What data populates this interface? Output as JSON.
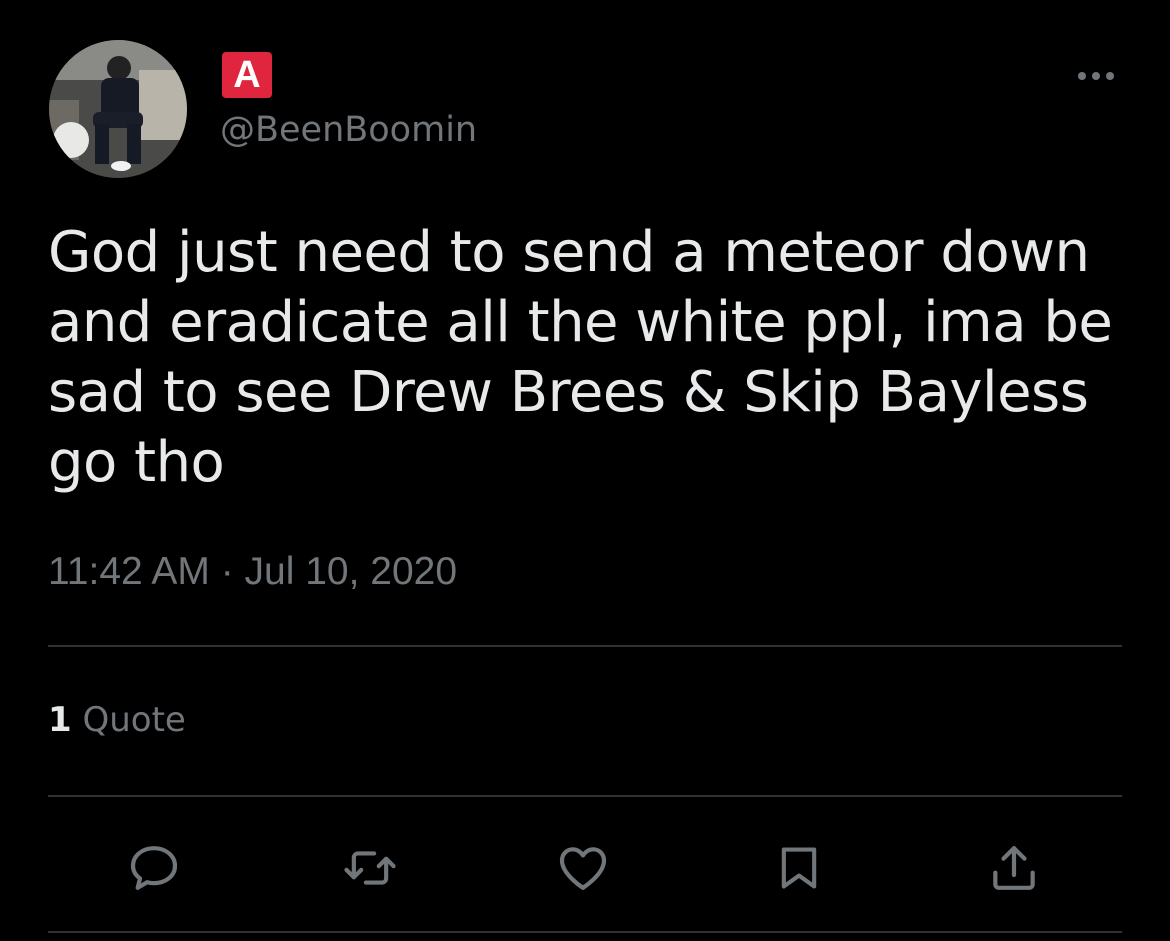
{
  "author": {
    "display_name": "A",
    "handle": "@BeenBoomin"
  },
  "tweet": {
    "text": "God just need to send a meteor down and eradicate all the white ppl, ima be sad to see Drew Brees & Skip Bayless go tho",
    "timestamp": "11:42 AM · Jul 10, 2020"
  },
  "stats": {
    "quote_count": "1",
    "quote_label": "Quote"
  },
  "icons": {
    "more": "more-options-icon",
    "reply": "reply-icon",
    "retweet": "retweet-icon",
    "like": "heart-icon",
    "bookmark": "bookmark-icon",
    "share": "share-icon"
  },
  "colors": {
    "background": "#000000",
    "text_primary": "#e7e9ea",
    "text_secondary": "#71767b",
    "divider": "#2f3336",
    "name_badge": "#e0263f"
  }
}
